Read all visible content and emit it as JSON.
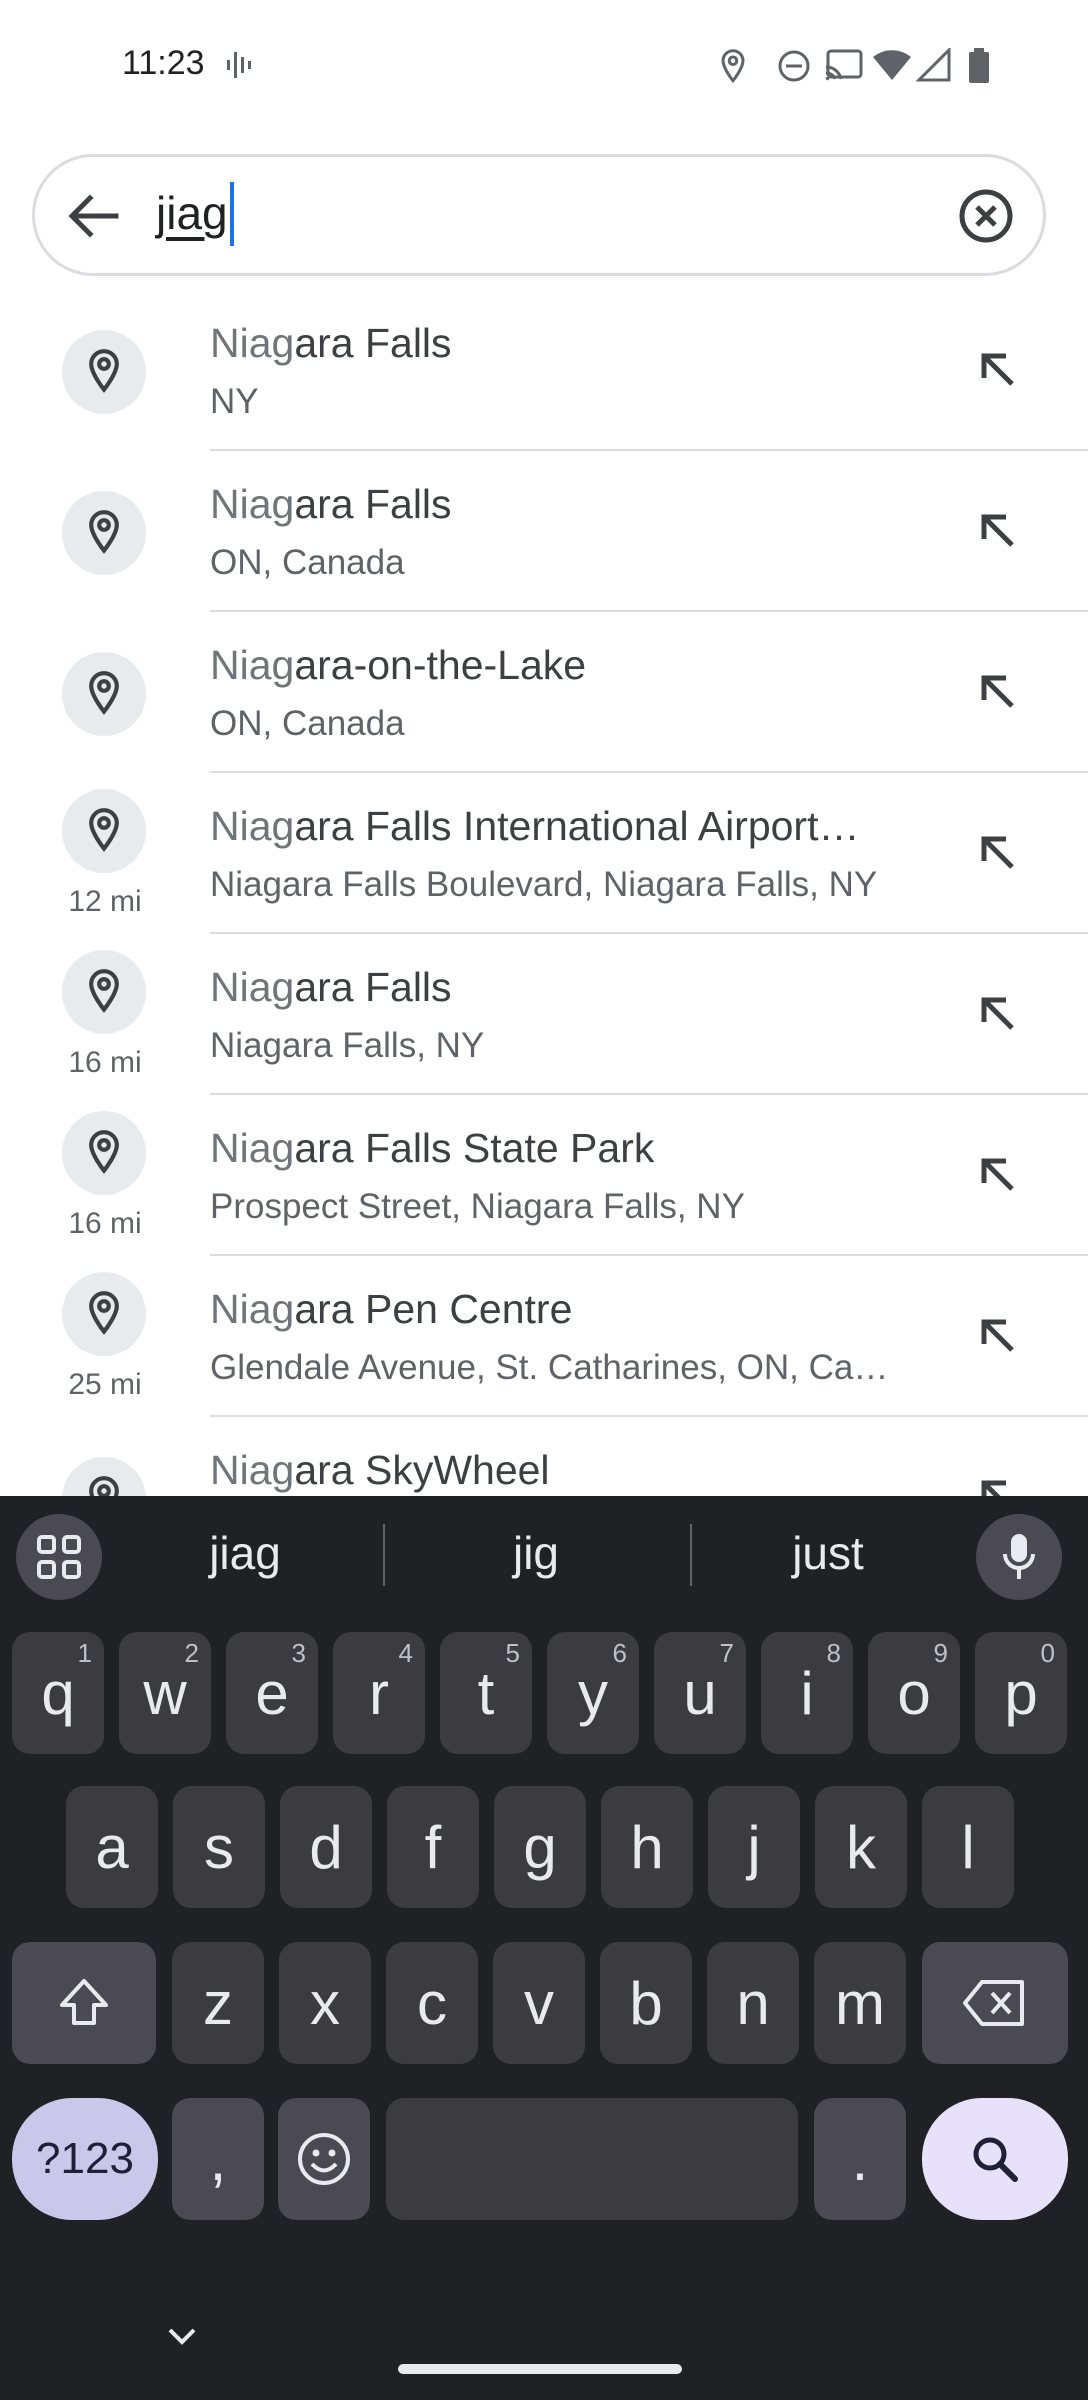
{
  "status_bar": {
    "time": "11:23"
  },
  "search": {
    "query": "jiag"
  },
  "results": [
    {
      "match": "Niag",
      "rest": "ara Falls",
      "subtitle": "NY",
      "distance": ""
    },
    {
      "match": "Niag",
      "rest": "ara Falls",
      "subtitle": "ON, Canada",
      "distance": ""
    },
    {
      "match": "Niag",
      "rest": "ara-on-the-Lake",
      "subtitle": "ON, Canada",
      "distance": ""
    },
    {
      "match": "Niag",
      "rest": "ara Falls International Airport…",
      "subtitle": "Niagara Falls Boulevard, Niagara Falls, NY",
      "distance": "12 mi"
    },
    {
      "match": "Niag",
      "rest": "ara Falls",
      "subtitle": "Niagara Falls, NY",
      "distance": "16 mi"
    },
    {
      "match": "Niag",
      "rest": "ara Falls State Park",
      "subtitle": "Prospect Street, Niagara Falls, NY",
      "distance": "16 mi"
    },
    {
      "match": "Niag",
      "rest": "ara Pen Centre",
      "subtitle": "Glendale Avenue, St. Catharines, ON, Ca…",
      "distance": "25 mi"
    },
    {
      "match": "Niag",
      "rest": "ara SkyWheel",
      "subtitle": "",
      "distance": ""
    }
  ],
  "keyboard": {
    "suggestions": [
      "jiag",
      "jig",
      "just"
    ],
    "row1": [
      {
        "k": "q",
        "h": "1"
      },
      {
        "k": "w",
        "h": "2"
      },
      {
        "k": "e",
        "h": "3"
      },
      {
        "k": "r",
        "h": "4"
      },
      {
        "k": "t",
        "h": "5"
      },
      {
        "k": "y",
        "h": "6"
      },
      {
        "k": "u",
        "h": "7"
      },
      {
        "k": "i",
        "h": "8"
      },
      {
        "k": "o",
        "h": "9"
      },
      {
        "k": "p",
        "h": "0"
      }
    ],
    "row2": [
      "a",
      "s",
      "d",
      "f",
      "g",
      "h",
      "j",
      "k",
      "l"
    ],
    "row3": [
      "z",
      "x",
      "c",
      "v",
      "b",
      "n",
      "m"
    ],
    "symbols_label": "?123",
    "comma": ",",
    "period": "."
  },
  "colors": {
    "accent": "#1a73e8",
    "keyboard_bg": "#202124",
    "key_bg": "#3c3c40",
    "symbols_key_bg": "#c9c7ea",
    "search_key_bg": "#e7e1fb"
  }
}
